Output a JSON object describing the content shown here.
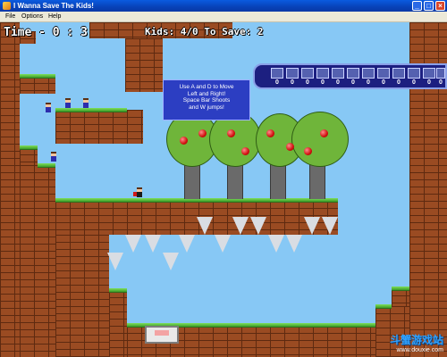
{
  "window": {
    "title": "I Wanna Save The Kids!",
    "minimize_glyph": "_",
    "maximize_glyph": "□",
    "close_glyph": "×"
  },
  "menu": {
    "items": [
      "File",
      "Options",
      "Help"
    ]
  },
  "hud": {
    "time_text": "Time - 0 : 3",
    "kids_text": "Kids: 4/0 To Save: 2"
  },
  "info_box": {
    "lines": [
      "Use A and D to Move",
      "Left and Right!",
      "Space Bar Shoots",
      "and W jumps!"
    ]
  },
  "inventory": {
    "counts": [
      "0",
      "0",
      "0",
      "0",
      "0",
      "0",
      "0",
      "0",
      "0",
      "0",
      "0",
      "0"
    ]
  },
  "watermark": {
    "brand_cn": "斗蟹游戏站",
    "url": "www.douxie.com"
  },
  "colors": {
    "sky": "#87c8f5",
    "brick": "#9a4b22",
    "grass": "#5bbf3b",
    "titlebar": "#0842b8"
  }
}
